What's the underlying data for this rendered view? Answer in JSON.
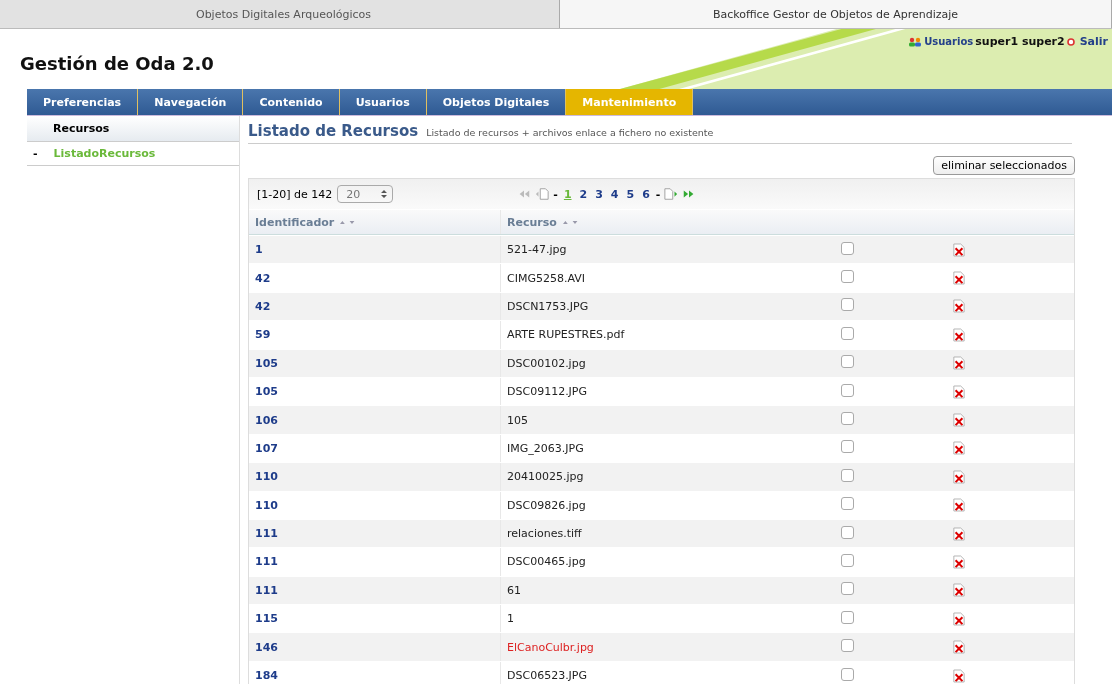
{
  "browser_tabs": [
    {
      "label": "Objetos Digitales Arqueológicos",
      "selected": false
    },
    {
      "label": "Backoffice Gestor de Objetos de Aprendizaje",
      "selected": true
    }
  ],
  "header": {
    "title": "Gestión de Oda 2.0",
    "users_link": "Usuarios",
    "user": "super1 super2",
    "logout": "Salir"
  },
  "nav": [
    {
      "label": "Preferencias",
      "selected": false
    },
    {
      "label": "Navegación",
      "selected": false
    },
    {
      "label": "Contenido",
      "selected": false
    },
    {
      "label": "Usuarios",
      "selected": false
    },
    {
      "label": "Objetos Digitales",
      "selected": false
    },
    {
      "label": "Mantenimiento",
      "selected": true
    }
  ],
  "sidebar": {
    "heading": "Recursos",
    "items": [
      {
        "bullet": "-",
        "label": "ListadoRecursos",
        "selected": true
      }
    ]
  },
  "content": {
    "title": "Listado de Recursos",
    "subtitle": "Listado de recursos + archivos enlace a fichero no existente",
    "delete_button": "eliminar seleccionados",
    "range": "[1-20] de 142",
    "page_size": "20",
    "pages": [
      {
        "label": "1",
        "selected": true
      },
      {
        "label": "2",
        "selected": false
      },
      {
        "label": "3",
        "selected": false
      },
      {
        "label": "4",
        "selected": false
      },
      {
        "label": "5",
        "selected": false
      },
      {
        "label": "6",
        "selected": false
      }
    ],
    "separator": "-",
    "columns": [
      "Identificador",
      "Recurso"
    ],
    "rows": [
      {
        "id": "1",
        "resource": "521-47.jpg",
        "missing": false,
        "checked": false
      },
      {
        "id": "42",
        "resource": "CIMG5258.AVI",
        "missing": false,
        "checked": false
      },
      {
        "id": "42",
        "resource": "DSCN1753.JPG",
        "missing": false,
        "checked": false
      },
      {
        "id": "59",
        "resource": "ARTE RUPESTRES.pdf",
        "missing": false,
        "checked": false
      },
      {
        "id": "105",
        "resource": "DSC00102.jpg",
        "missing": false,
        "checked": false
      },
      {
        "id": "105",
        "resource": "DSC09112.JPG",
        "missing": false,
        "checked": false
      },
      {
        "id": "106",
        "resource": "105",
        "missing": false,
        "checked": false
      },
      {
        "id": "107",
        "resource": "IMG_2063.JPG",
        "missing": false,
        "checked": false
      },
      {
        "id": "110",
        "resource": "20410025.jpg",
        "missing": false,
        "checked": false
      },
      {
        "id": "110",
        "resource": "DSC09826.jpg",
        "missing": false,
        "checked": false
      },
      {
        "id": "111",
        "resource": "relaciones.tiff",
        "missing": false,
        "checked": false
      },
      {
        "id": "111",
        "resource": "DSC00465.jpg",
        "missing": false,
        "checked": false
      },
      {
        "id": "111",
        "resource": "61",
        "missing": false,
        "checked": false
      },
      {
        "id": "115",
        "resource": "1",
        "missing": false,
        "checked": false
      },
      {
        "id": "146",
        "resource": "ElCanoCulbr.jpg",
        "missing": true,
        "checked": false
      },
      {
        "id": "184",
        "resource": "DSC06523.JPG",
        "missing": false,
        "checked": false
      }
    ]
  }
}
